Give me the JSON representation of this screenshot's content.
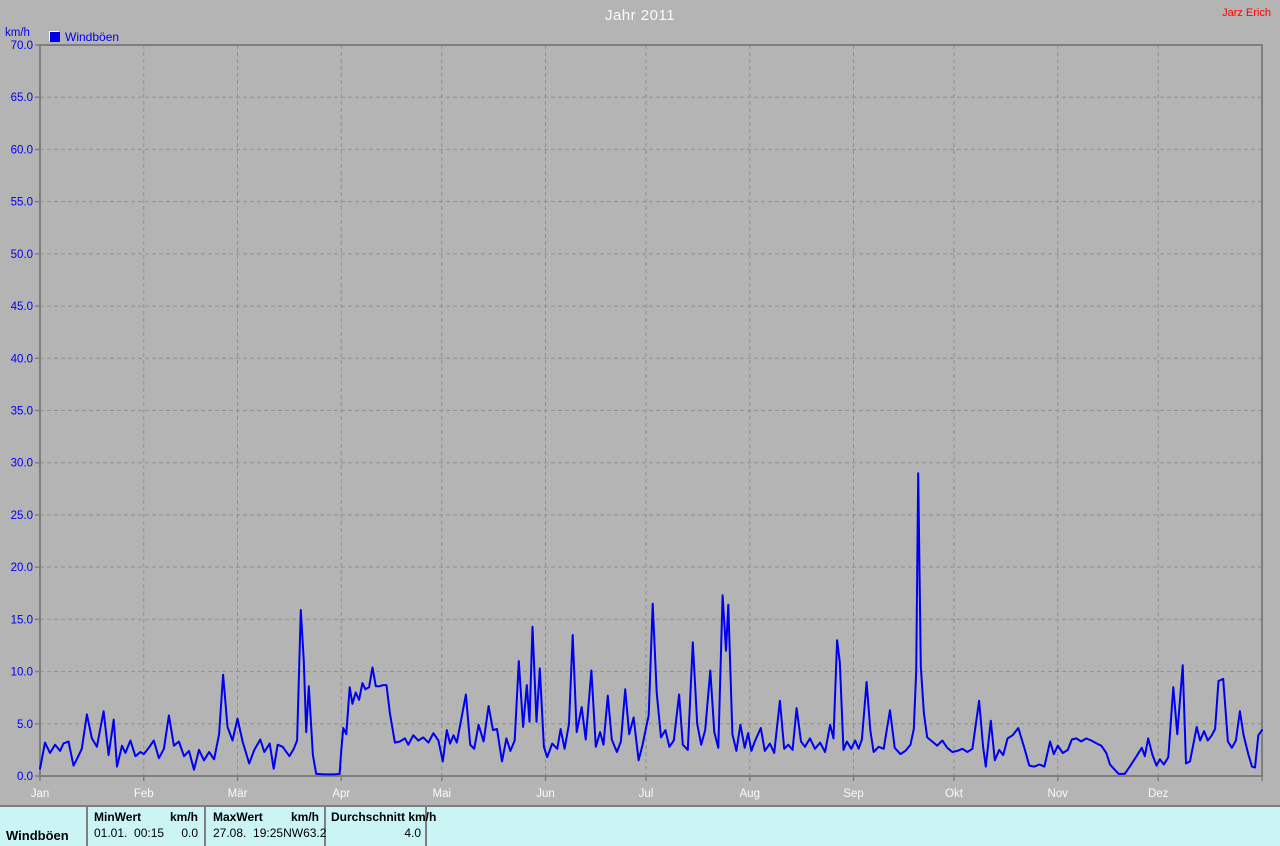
{
  "header": {
    "title": "Jahr 2011",
    "credit": "Jarz Erich",
    "unit_label": "km/h"
  },
  "legend": {
    "label": "Windböen"
  },
  "colors": {
    "background": "#b4b4b4",
    "line": "#0000f0",
    "axis_text": "#0000f0",
    "month_text": "#fafafa",
    "title_text": "#fafafa",
    "credit_text": "#ff0000",
    "frame": "#7e7e7e",
    "grid": "#8f8f8f",
    "table_bg": "#cbf5f5"
  },
  "chart_data": {
    "type": "line",
    "title": "Jahr 2011",
    "ylabel": "km/h",
    "xlabel": "",
    "ylim": [
      0,
      70
    ],
    "ytick_step": 5,
    "ytick_labels": [
      "0.0",
      "5.0",
      "10.0",
      "15.0",
      "20.0",
      "25.0",
      "30.0",
      "35.0",
      "40.0",
      "45.0",
      "50.0",
      "55.0",
      "60.0",
      "65.0",
      "70.0"
    ],
    "x_range_days": 365,
    "months": [
      [
        "Jan",
        0
      ],
      [
        "Feb",
        31
      ],
      [
        "Mär",
        59
      ],
      [
        "Apr",
        90
      ],
      [
        "Mai",
        120
      ],
      [
        "Jun",
        151
      ],
      [
        "Jul",
        181
      ],
      [
        "Aug",
        212
      ],
      [
        "Sep",
        243
      ],
      [
        "Okt",
        273
      ],
      [
        "Nov",
        304
      ],
      [
        "Dez",
        334
      ]
    ],
    "grid": true,
    "legend_position": "top-left",
    "series": [
      {
        "name": "Windböen",
        "color": "#0000f0",
        "points": [
          [
            0,
            0.7
          ],
          [
            1.5,
            3.2
          ],
          [
            3,
            2.2
          ],
          [
            4.5,
            3.0
          ],
          [
            6,
            2.4
          ],
          [
            7,
            3.1
          ],
          [
            8.5,
            3.3
          ],
          [
            10,
            1.0
          ],
          [
            11,
            1.6
          ],
          [
            12.5,
            2.6
          ],
          [
            14,
            5.9
          ],
          [
            15.5,
            3.6
          ],
          [
            17,
            2.8
          ],
          [
            19,
            6.2
          ],
          [
            20.5,
            2.0
          ],
          [
            22,
            5.4
          ],
          [
            23,
            0.9
          ],
          [
            24.5,
            2.9
          ],
          [
            25.5,
            2.2
          ],
          [
            27,
            3.4
          ],
          [
            28.5,
            1.9
          ],
          [
            30,
            2.3
          ],
          [
            31,
            2.1
          ],
          [
            32.5,
            2.7
          ],
          [
            34,
            3.4
          ],
          [
            35.5,
            1.7
          ],
          [
            37,
            2.6
          ],
          [
            38.5,
            5.8
          ],
          [
            40,
            2.9
          ],
          [
            41.5,
            3.3
          ],
          [
            43,
            1.9
          ],
          [
            44.5,
            2.4
          ],
          [
            46,
            0.6
          ],
          [
            47.5,
            2.5
          ],
          [
            49,
            1.5
          ],
          [
            50.5,
            2.3
          ],
          [
            52,
            1.6
          ],
          [
            53.5,
            4.0
          ],
          [
            54.7,
            9.7
          ],
          [
            56,
            4.7
          ],
          [
            57.5,
            3.4
          ],
          [
            59,
            5.5
          ],
          [
            60.5,
            3.3
          ],
          [
            62.5,
            1.2
          ],
          [
            64,
            2.5
          ],
          [
            65.8,
            3.5
          ],
          [
            67,
            2.3
          ],
          [
            68.6,
            3.1
          ],
          [
            69.8,
            0.7
          ],
          [
            71,
            3.0
          ],
          [
            72.5,
            2.8
          ],
          [
            74.5,
            1.9
          ],
          [
            75.8,
            2.6
          ],
          [
            76.8,
            3.4
          ],
          [
            77.9,
            15.9
          ],
          [
            78.8,
            11.0
          ],
          [
            79.5,
            4.2
          ],
          [
            80.3,
            8.6
          ],
          [
            81.5,
            2.0
          ],
          [
            82.5,
            0.2
          ],
          [
            85,
            0.15
          ],
          [
            88,
            0.15
          ],
          [
            89.5,
            0.2
          ],
          [
            90,
            2.5
          ],
          [
            90.6,
            4.6
          ],
          [
            91.5,
            4.0
          ],
          [
            92.5,
            8.5
          ],
          [
            93.3,
            6.9
          ],
          [
            94.3,
            8.0
          ],
          [
            95.3,
            7.3
          ],
          [
            96.3,
            8.9
          ],
          [
            97.2,
            8.3
          ],
          [
            98.3,
            8.5
          ],
          [
            99.3,
            10.4
          ],
          [
            100.3,
            8.6
          ],
          [
            101.5,
            8.6
          ],
          [
            102.5,
            8.7
          ],
          [
            103.5,
            8.7
          ],
          [
            104.5,
            6.0
          ],
          [
            106,
            3.2
          ],
          [
            107.5,
            3.3
          ],
          [
            109,
            3.6
          ],
          [
            110,
            3.0
          ],
          [
            111.5,
            3.9
          ],
          [
            113,
            3.4
          ],
          [
            114.5,
            3.7
          ],
          [
            116,
            3.2
          ],
          [
            117.5,
            4.1
          ],
          [
            119,
            3.4
          ],
          [
            120.3,
            1.4
          ],
          [
            121.5,
            4.4
          ],
          [
            122.5,
            3.1
          ],
          [
            123.5,
            3.9
          ],
          [
            124.5,
            3.2
          ],
          [
            125.7,
            5.2
          ],
          [
            127.2,
            7.8
          ],
          [
            128.5,
            3.0
          ],
          [
            129.7,
            2.6
          ],
          [
            131,
            4.9
          ],
          [
            132.5,
            3.3
          ],
          [
            134,
            6.7
          ],
          [
            135.3,
            4.4
          ],
          [
            136.5,
            4.5
          ],
          [
            138,
            1.4
          ],
          [
            139.3,
            3.6
          ],
          [
            140.5,
            2.4
          ],
          [
            141.8,
            3.4
          ],
          [
            143,
            11.0
          ],
          [
            144.3,
            4.7
          ],
          [
            145.4,
            8.7
          ],
          [
            146.2,
            5.2
          ],
          [
            147.1,
            14.3
          ],
          [
            148.3,
            5.2
          ],
          [
            149.3,
            10.3
          ],
          [
            150.5,
            2.8
          ],
          [
            151.5,
            1.8
          ],
          [
            153,
            3.1
          ],
          [
            154.5,
            2.6
          ],
          [
            155.5,
            4.5
          ],
          [
            156.7,
            2.6
          ],
          [
            158,
            5.0
          ],
          [
            159.1,
            13.5
          ],
          [
            160.3,
            4.2
          ],
          [
            161.8,
            6.6
          ],
          [
            163,
            3.5
          ],
          [
            164.7,
            10.1
          ],
          [
            166,
            2.8
          ],
          [
            167.3,
            4.2
          ],
          [
            168.3,
            3.0
          ],
          [
            169.6,
            7.7
          ],
          [
            170.8,
            3.5
          ],
          [
            172.3,
            2.3
          ],
          [
            173.5,
            3.3
          ],
          [
            174.8,
            8.3
          ],
          [
            176,
            4.0
          ],
          [
            177.3,
            5.6
          ],
          [
            178.8,
            1.5
          ],
          [
            180,
            3.0
          ],
          [
            181,
            4.6
          ],
          [
            181.8,
            5.8
          ],
          [
            183,
            16.5
          ],
          [
            184.2,
            8.0
          ],
          [
            185.5,
            3.7
          ],
          [
            186.8,
            4.4
          ],
          [
            188,
            2.8
          ],
          [
            189.3,
            3.4
          ],
          [
            190.9,
            7.8
          ],
          [
            192,
            3.0
          ],
          [
            193.5,
            2.5
          ],
          [
            195,
            12.8
          ],
          [
            196.3,
            5.0
          ],
          [
            197.5,
            3.0
          ],
          [
            198.7,
            4.4
          ],
          [
            200.2,
            10.1
          ],
          [
            201.4,
            4.2
          ],
          [
            202.6,
            2.7
          ],
          [
            203.9,
            17.3
          ],
          [
            204.9,
            12.0
          ],
          [
            205.6,
            16.4
          ],
          [
            206.8,
            4.0
          ],
          [
            208,
            2.4
          ],
          [
            209.2,
            4.9
          ],
          [
            210.5,
            2.7
          ],
          [
            211.5,
            4.1
          ],
          [
            212.5,
            2.4
          ],
          [
            213.5,
            3.3
          ],
          [
            215.3,
            4.6
          ],
          [
            216.5,
            2.4
          ],
          [
            218,
            3.1
          ],
          [
            219.3,
            2.2
          ],
          [
            221,
            7.2
          ],
          [
            222.3,
            2.6
          ],
          [
            223.5,
            3.0
          ],
          [
            224.8,
            2.5
          ],
          [
            226,
            6.5
          ],
          [
            227.3,
            3.3
          ],
          [
            228.5,
            2.8
          ],
          [
            230,
            3.6
          ],
          [
            231.5,
            2.6
          ],
          [
            233,
            3.2
          ],
          [
            234.5,
            2.3
          ],
          [
            236,
            4.9
          ],
          [
            237,
            3.6
          ],
          [
            238.1,
            13.0
          ],
          [
            238.9,
            10.9
          ],
          [
            240,
            2.5
          ],
          [
            241,
            3.3
          ],
          [
            242.3,
            2.6
          ],
          [
            243.5,
            3.4
          ],
          [
            244.5,
            2.6
          ],
          [
            245.5,
            3.5
          ],
          [
            246.9,
            9.0
          ],
          [
            248,
            4.4
          ],
          [
            249,
            2.3
          ],
          [
            250.5,
            2.8
          ],
          [
            252,
            2.6
          ],
          [
            253.9,
            6.3
          ],
          [
            255.3,
            2.7
          ],
          [
            257,
            2.1
          ],
          [
            258.5,
            2.4
          ],
          [
            260,
            3.0
          ],
          [
            261,
            4.5
          ],
          [
            261.7,
            10.0
          ],
          [
            262.3,
            29.0
          ],
          [
            263.1,
            10.5
          ],
          [
            264,
            6.0
          ],
          [
            265,
            3.7
          ],
          [
            266.5,
            3.3
          ],
          [
            268,
            2.9
          ],
          [
            269.5,
            3.4
          ],
          [
            271,
            2.7
          ],
          [
            272.5,
            2.3
          ],
          [
            274,
            2.4
          ],
          [
            275.5,
            2.6
          ],
          [
            277,
            2.3
          ],
          [
            278.5,
            2.6
          ],
          [
            280.5,
            7.2
          ],
          [
            281.7,
            2.8
          ],
          [
            282.5,
            0.9
          ],
          [
            284,
            5.3
          ],
          [
            285.2,
            1.5
          ],
          [
            286.5,
            2.5
          ],
          [
            287.7,
            2.0
          ],
          [
            289,
            3.6
          ],
          [
            290.5,
            3.9
          ],
          [
            292.2,
            4.6
          ],
          [
            294,
            2.7
          ],
          [
            295.5,
            1.0
          ],
          [
            297,
            0.9
          ],
          [
            298.5,
            1.1
          ],
          [
            300,
            0.9
          ],
          [
            301.7,
            3.3
          ],
          [
            302.8,
            2.1
          ],
          [
            304,
            2.9
          ],
          [
            305.5,
            2.2
          ],
          [
            307,
            2.5
          ],
          [
            308.2,
            3.5
          ],
          [
            309.5,
            3.6
          ],
          [
            311,
            3.3
          ],
          [
            312.5,
            3.6
          ],
          [
            314,
            3.4
          ],
          [
            315.7,
            3.1
          ],
          [
            317,
            2.9
          ],
          [
            318.5,
            2.2
          ],
          [
            319.6,
            1.1
          ],
          [
            321,
            0.6
          ],
          [
            322.2,
            0.2
          ],
          [
            324,
            0.2
          ],
          [
            325.5,
            0.9
          ],
          [
            327.5,
            1.9
          ],
          [
            329.1,
            2.7
          ],
          [
            330,
            1.9
          ],
          [
            331,
            3.6
          ],
          [
            332.3,
            2.0
          ],
          [
            333.5,
            1.0
          ],
          [
            334.5,
            1.6
          ],
          [
            335.7,
            1.1
          ],
          [
            337,
            1.8
          ],
          [
            338.5,
            8.5
          ],
          [
            339.7,
            4.0
          ],
          [
            341.3,
            10.6
          ],
          [
            342.3,
            1.2
          ],
          [
            343.5,
            1.4
          ],
          [
            345.5,
            4.7
          ],
          [
            346.5,
            3.4
          ],
          [
            347.7,
            4.3
          ],
          [
            348.8,
            3.4
          ],
          [
            350,
            3.9
          ],
          [
            351,
            4.5
          ],
          [
            352,
            9.1
          ],
          [
            353.4,
            9.3
          ],
          [
            354.8,
            3.3
          ],
          [
            356,
            2.7
          ],
          [
            357.2,
            3.4
          ],
          [
            358.4,
            6.2
          ],
          [
            359.5,
            3.9
          ],
          [
            360.9,
            2.1
          ],
          [
            362,
            0.9
          ],
          [
            362.9,
            0.8
          ],
          [
            363.9,
            3.9
          ],
          [
            365,
            4.4
          ]
        ]
      }
    ]
  },
  "table": {
    "row_label": "Windböen",
    "min": {
      "header": "MinWert",
      "unit": "km/h",
      "date": "01.01.  00:15",
      "value": "0.0"
    },
    "max": {
      "header": "MaxWert",
      "unit": "km/h",
      "date": "27.08.  19:25",
      "direction": "NW",
      "value": "63.2"
    },
    "avg": {
      "header": "Durchschnitt km/h",
      "value": "4.0"
    }
  }
}
